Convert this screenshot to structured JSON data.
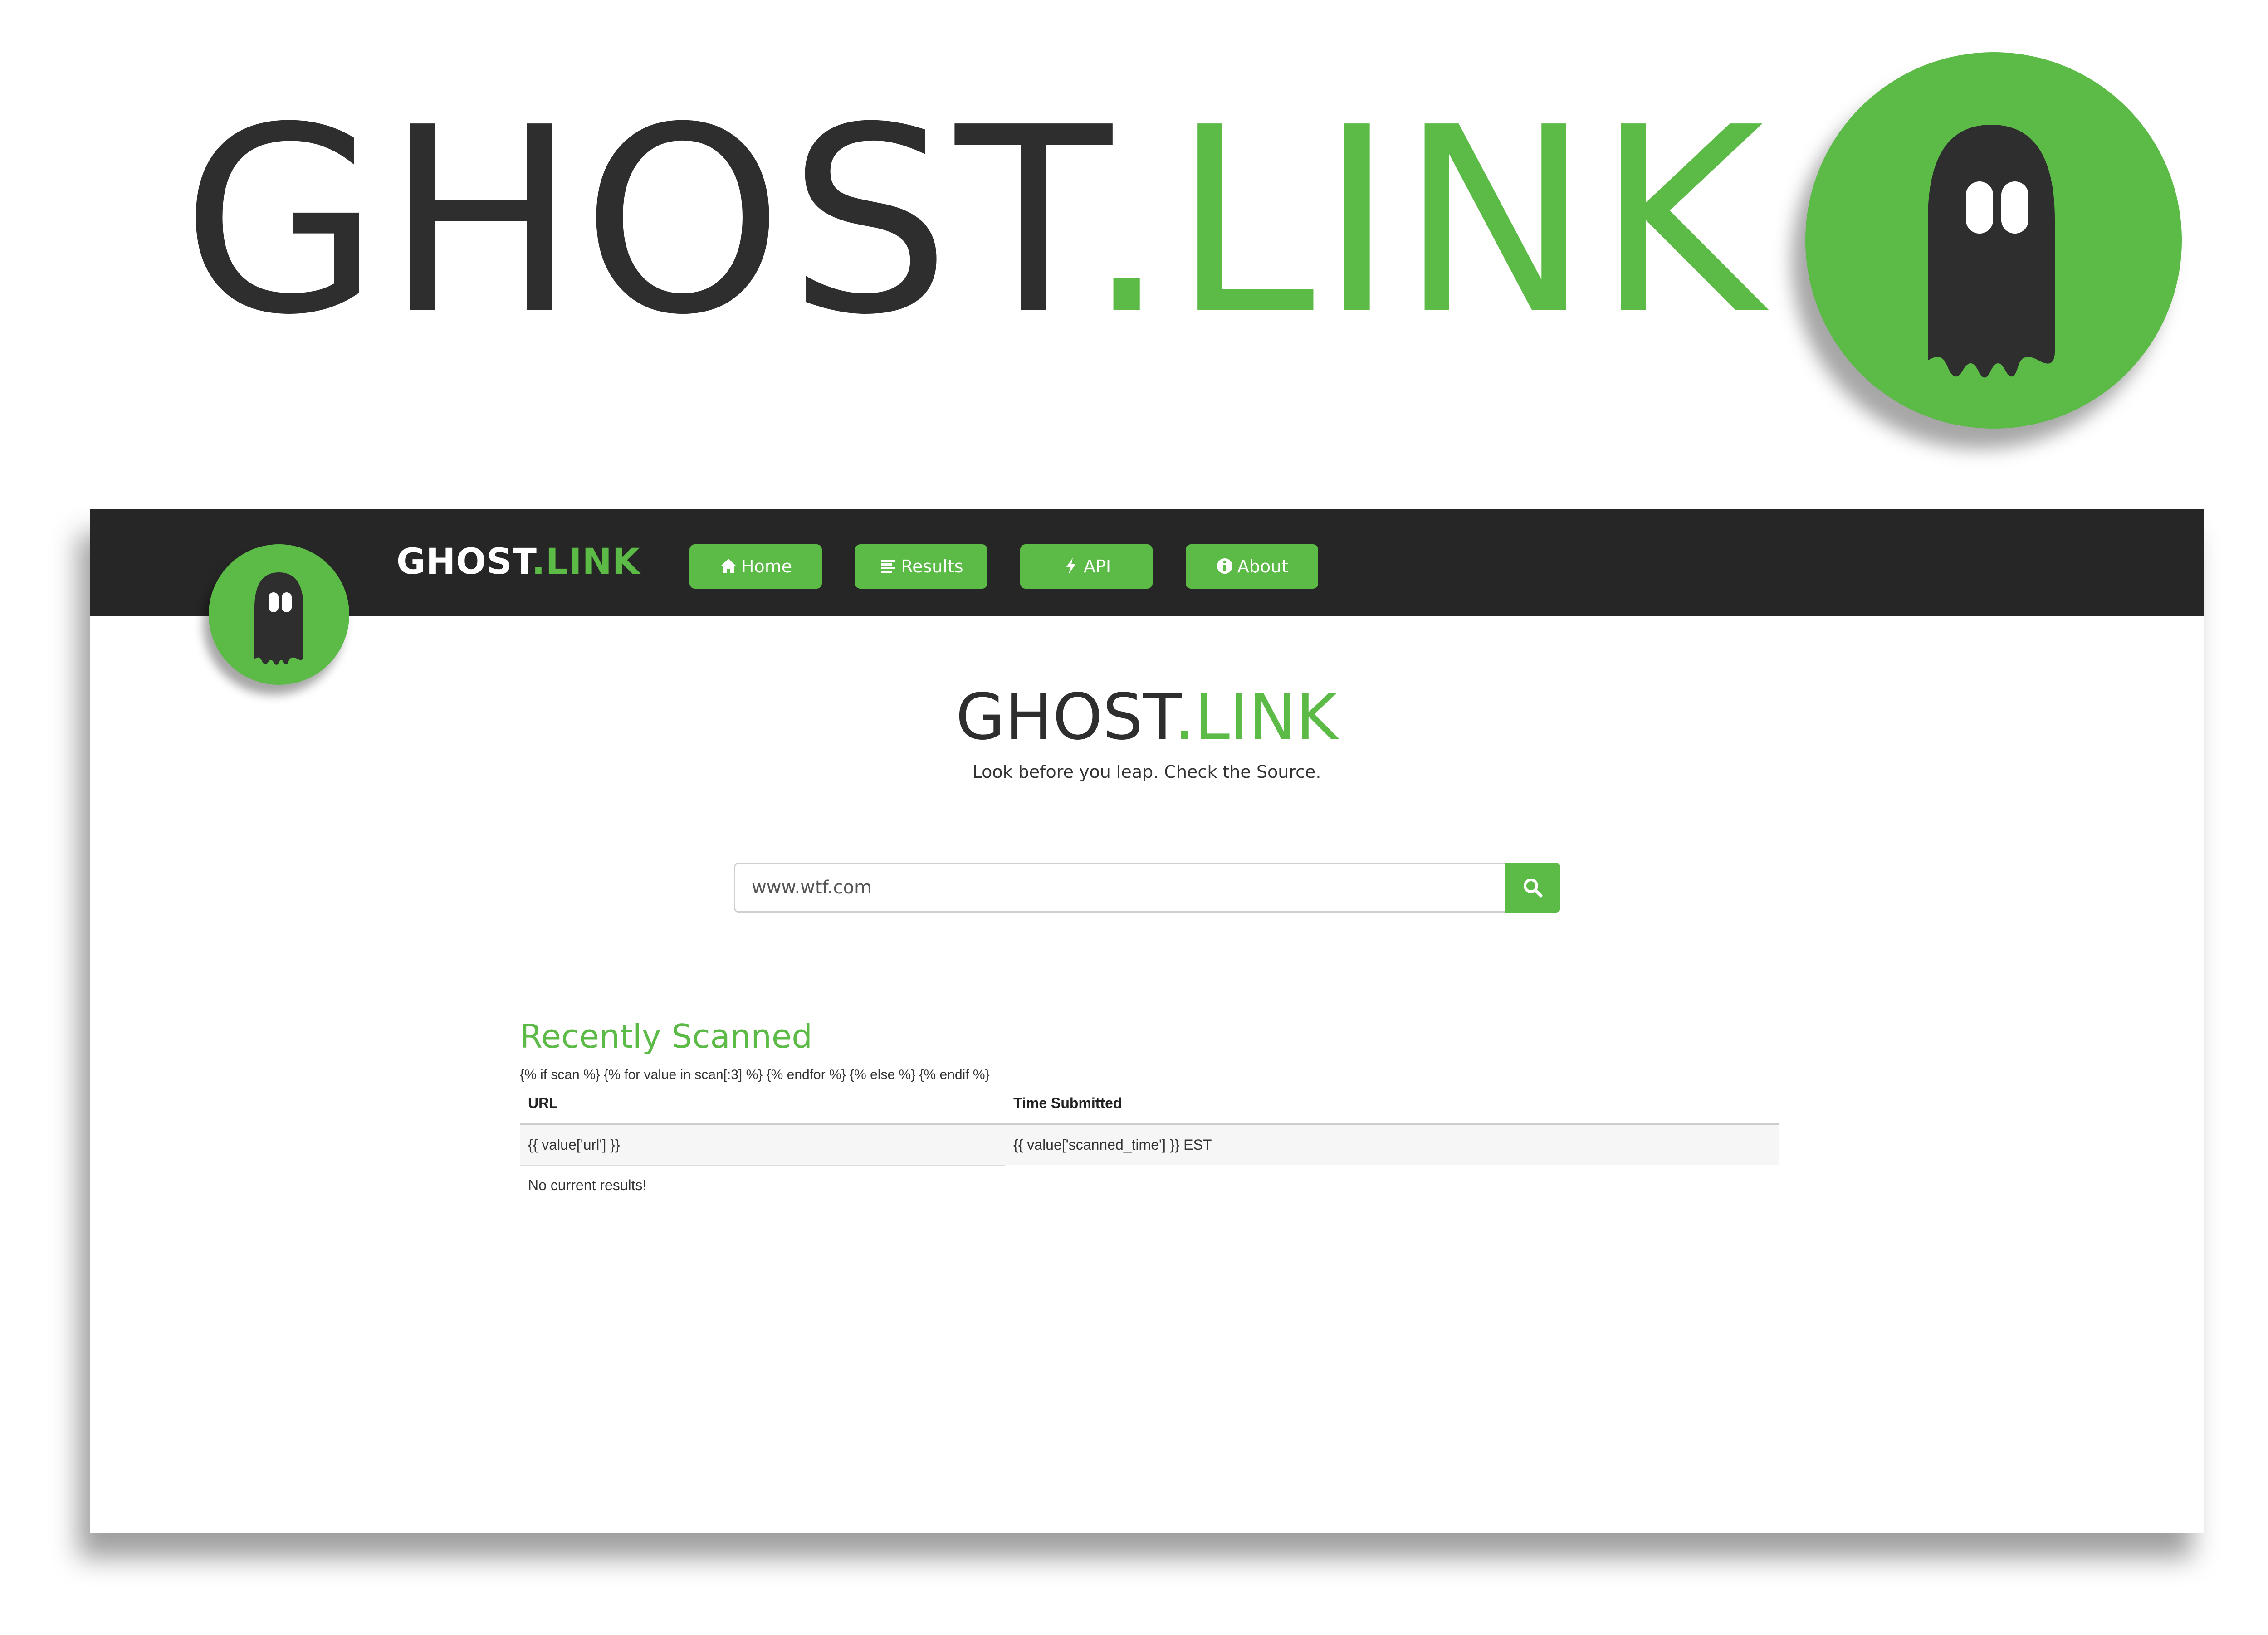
{
  "hero": {
    "brand_dark": "GHOST",
    "brand_green": ".LINK",
    "logo_icon": "ghost-icon"
  },
  "colors": {
    "brand_green": "#5cba47",
    "brand_dark": "#2e2e2e",
    "navbar_bg": "#262626"
  },
  "navbar": {
    "brand_dark": "GHOST",
    "brand_green": ".LINK",
    "logo_icon": "ghost-icon",
    "items": [
      {
        "label": "Home",
        "icon": "home-icon"
      },
      {
        "label": "Results",
        "icon": "list-icon"
      },
      {
        "label": "API",
        "icon": "bolt-icon"
      },
      {
        "label": "About",
        "icon": "info-icon"
      }
    ]
  },
  "main": {
    "title_dark": "GHOST",
    "title_green": ".LINK",
    "tagline": "Look before you leap. Check the Source.",
    "search": {
      "value": "www.wtf.com",
      "button_icon": "search-icon"
    }
  },
  "recent": {
    "title": "Recently Scanned",
    "template_line": "{% if scan %} {% for value in scan[:3] %} {% endfor %} {% else %} {% endif %}",
    "columns": [
      "URL",
      "Time Submitted"
    ],
    "row": [
      "{{ value['url'] }}",
      "{{ value['scanned_time'] }} EST"
    ],
    "empty_message": "No current results!"
  }
}
